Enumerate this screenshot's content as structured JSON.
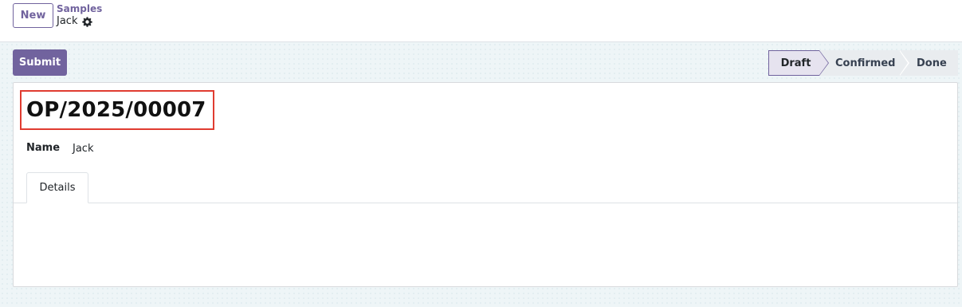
{
  "control_panel": {
    "new_label": "New",
    "breadcrumb": "Samples",
    "record_title": "Jack",
    "settings_icon": "gear-icon"
  },
  "form": {
    "submit_label": "Submit",
    "statusbar": {
      "stages": [
        "Draft",
        "Confirmed",
        "Done"
      ],
      "current": "Draft"
    },
    "reference": "OP/2025/00007",
    "fields": {
      "name_label": "Name",
      "name_value": "Jack"
    },
    "tabs": [
      "Details"
    ]
  },
  "colors": {
    "brand": "#71639e",
    "highlight_box": "#e03c31"
  }
}
